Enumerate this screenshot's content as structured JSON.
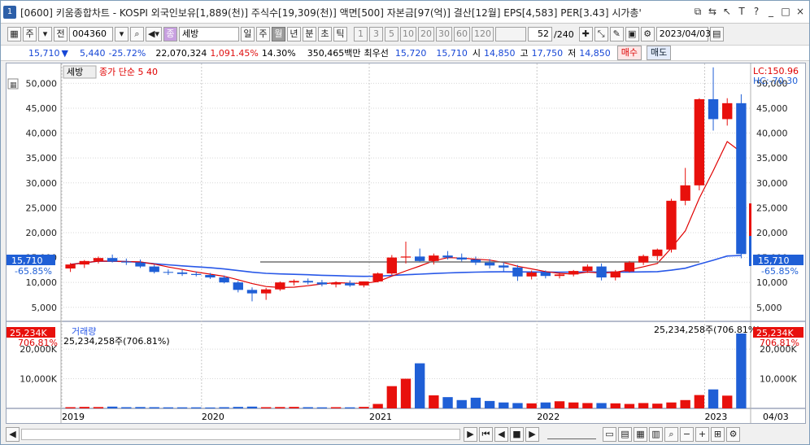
{
  "title": {
    "window_num": "1",
    "text": "[0600] 키움종합차트 - KOSPI 외국인보유[1,889(천)] 주식수[19,309(천)] 액면[500] 자본금[97(억)] 결산[12월] EPS[4,583] PER[3.43] 시가총'"
  },
  "window_controls": [
    "⧉",
    "⇆",
    "↖",
    "ɴ",
    "T",
    "?",
    "_",
    "□",
    "×"
  ],
  "toolbar": {
    "period_sel": "주",
    "jeon": "전",
    "code": "004360",
    "stock_name": "세방",
    "periods": [
      "일",
      "주",
      "월",
      "년",
      "분",
      "초",
      "틱"
    ],
    "active_period": "월",
    "nums": [
      "1",
      "3",
      "5",
      "10",
      "20",
      "30",
      "60",
      "120"
    ],
    "count": "52",
    "count_total": "/240",
    "date": "2023/04/03"
  },
  "quote": {
    "price": "15,710",
    "arrow": "▼",
    "change": "5,440",
    "pct": "-25.72%",
    "volume": "22,070,324",
    "vol_pct": "1,091.45%",
    "turnover": "14.30%",
    "amount": "350,465백만",
    "pref_label": "최우선",
    "ask": "15,720",
    "bid": "15,710",
    "open_label": "시",
    "open": "14,850",
    "high_label": "고",
    "high": "17,750",
    "low_label": "저",
    "low": "14,850",
    "buy": "매수",
    "sell": "매도"
  },
  "price_panel": {
    "legend_stock": "세방",
    "legend_ma": "종가 단순 5  40",
    "lc": "LC:150.96",
    "hc": "HC:-70.30",
    "cur_price": "15,710",
    "cur_pct": "-65.85%",
    "y_labels": [
      "50,000",
      "45,000",
      "40,000",
      "35,000",
      "30,000",
      "25,000",
      "20,000",
      "15,000",
      "10,000",
      "5,000"
    ]
  },
  "volume_panel": {
    "legend": "거래량",
    "cur": "25,234K",
    "cur_pct": "706.81%",
    "note": "25,234,258주(706.81%)",
    "top_note": "25,234,258주(706.81%)",
    "y_labels": [
      "20,000K",
      "10,000K"
    ]
  },
  "x_labels": [
    "2019",
    "2020",
    "2021",
    "2022",
    "2023"
  ],
  "x_right": "04/03",
  "colors": {
    "up": "#e8100c",
    "down": "#1f5fd6",
    "ma5": "#e00000",
    "ma40": "#2858e8"
  },
  "chart_data": {
    "type": "candlestick",
    "period": "monthly",
    "candles": [
      [
        12800,
        13900,
        12100,
        13600
      ],
      [
        13600,
        14500,
        12900,
        14300
      ],
      [
        14300,
        15200,
        13800,
        14900
      ],
      [
        14900,
        15600,
        14000,
        14200
      ],
      [
        14200,
        14800,
        13500,
        14000
      ],
      [
        14000,
        14600,
        12900,
        13200
      ],
      [
        13200,
        13600,
        11800,
        12100
      ],
      [
        12100,
        12600,
        11500,
        12000
      ],
      [
        12000,
        12500,
        11300,
        11700
      ],
      [
        11700,
        12200,
        11200,
        11500
      ],
      [
        11500,
        11900,
        10700,
        11000
      ],
      [
        11000,
        11400,
        9800,
        10000
      ],
      [
        10000,
        10300,
        8000,
        8500
      ],
      [
        8500,
        9000,
        6200,
        7800
      ],
      [
        7800,
        8900,
        6500,
        8600
      ],
      [
        8600,
        10200,
        8300,
        10000
      ],
      [
        10000,
        10600,
        9400,
        10300
      ],
      [
        10300,
        10800,
        9600,
        10000
      ],
      [
        10000,
        10500,
        9200,
        9600
      ],
      [
        9600,
        10200,
        9000,
        9900
      ],
      [
        9900,
        10400,
        9100,
        9400
      ],
      [
        9400,
        10200,
        9000,
        10200
      ],
      [
        10200,
        12000,
        10000,
        11800
      ],
      [
        11800,
        15500,
        11500,
        15000
      ],
      [
        15000,
        18200,
        13800,
        15200
      ],
      [
        15200,
        16800,
        14100,
        14300
      ],
      [
        14300,
        15800,
        13600,
        15400
      ],
      [
        15400,
        16300,
        14600,
        15000
      ],
      [
        15000,
        15800,
        14200,
        14600
      ],
      [
        14600,
        15200,
        13500,
        14000
      ],
      [
        14000,
        14700,
        12800,
        13400
      ],
      [
        13400,
        14000,
        12200,
        13000
      ],
      [
        13000,
        13500,
        10300,
        11200
      ],
      [
        11200,
        12400,
        10600,
        12000
      ],
      [
        12000,
        12400,
        10800,
        11300
      ],
      [
        11300,
        12000,
        10800,
        11600
      ],
      [
        11600,
        12500,
        11200,
        12300
      ],
      [
        12300,
        13600,
        11900,
        13200
      ],
      [
        13200,
        13800,
        10400,
        11000
      ],
      [
        11000,
        12500,
        10400,
        12200
      ],
      [
        12200,
        14300,
        12000,
        14000
      ],
      [
        14000,
        15600,
        13500,
        15300
      ],
      [
        15300,
        16800,
        14400,
        16600
      ],
      [
        16600,
        26800,
        16000,
        26400
      ],
      [
        26400,
        33000,
        25500,
        29500
      ],
      [
        29500,
        47000,
        28500,
        46800
      ],
      [
        46800,
        53200,
        40500,
        42800
      ],
      [
        42800,
        47000,
        41500,
        46000
      ],
      [
        46000,
        47800,
        14850,
        15710
      ]
    ],
    "volumes_k": [
      400,
      500,
      450,
      600,
      400,
      450,
      400,
      350,
      350,
      350,
      300,
      400,
      500,
      600,
      400,
      450,
      500,
      400,
      350,
      400,
      350,
      500,
      1500,
      7500,
      10000,
      15200,
      4400,
      3800,
      2800,
      3600,
      2500,
      2000,
      1800,
      1700,
      2000,
      2400,
      2000,
      1800,
      1800,
      1700,
      1500,
      1800,
      1600,
      2000,
      2800,
      4500,
      6400,
      4300,
      25234
    ],
    "ylim": [
      3000,
      53000
    ],
    "vol_ylim": [
      0,
      25234
    ]
  }
}
